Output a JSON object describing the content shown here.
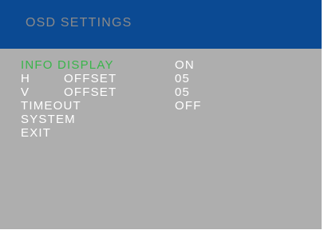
{
  "header": {
    "title": "OSD SETTINGS"
  },
  "menu": {
    "items": [
      {
        "label": "INFO DISPLAY",
        "value": "ON",
        "selected": true
      },
      {
        "prefix": "H",
        "label": "OFFSET",
        "value": "05"
      },
      {
        "prefix": "V",
        "label": "OFFSET",
        "value": "05"
      },
      {
        "label": "TIMEOUT",
        "value": "OFF"
      },
      {
        "label": "SYSTEM"
      },
      {
        "label": "EXIT"
      }
    ]
  },
  "colors": {
    "header_bg": "#0b4a93",
    "panel_bg": "#aeaeae",
    "selected_text": "#39b54a",
    "text": "#ffffff"
  }
}
